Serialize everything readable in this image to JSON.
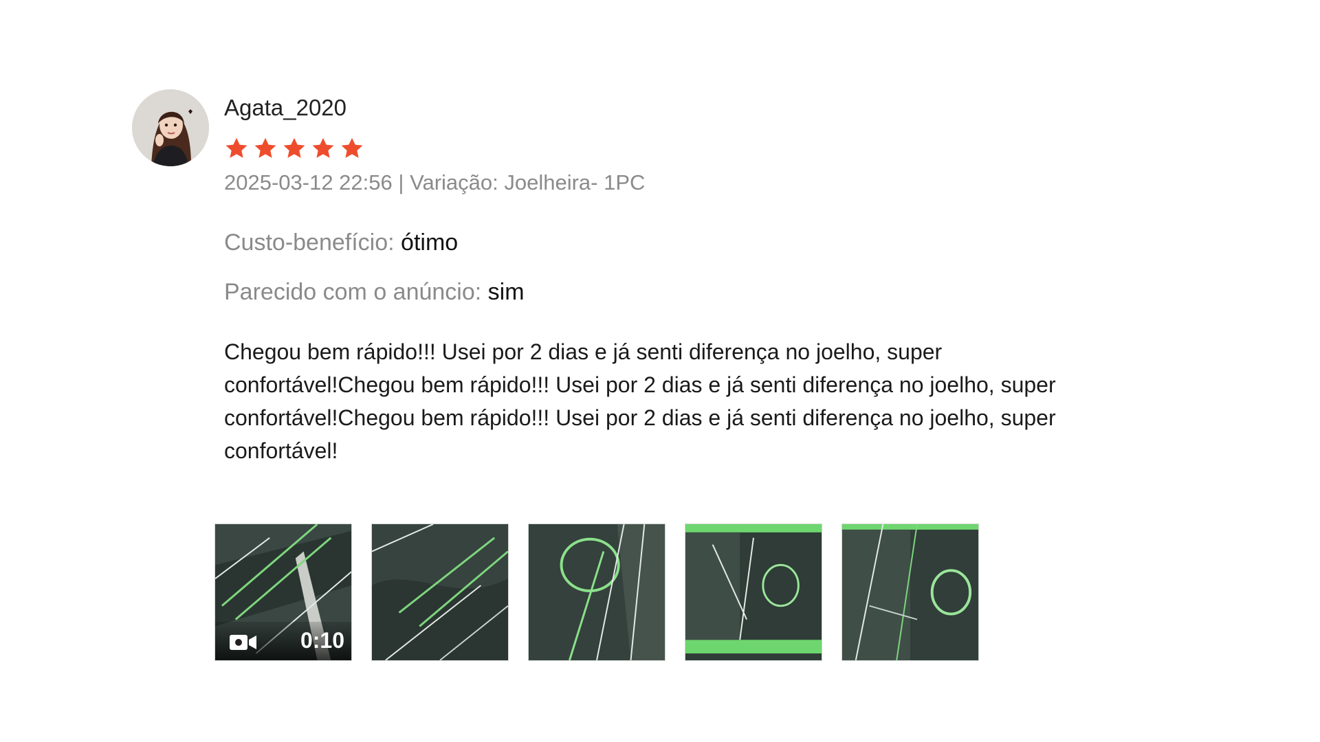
{
  "review": {
    "username": "Agata_2020",
    "rating": 5,
    "rating_max": 5,
    "star_color": "#ee4d2d",
    "date": "2025-03-12 22:56",
    "separator": "|",
    "variation_label": "Variação:",
    "variation_value": "Joelheira- 1PC",
    "attributes": [
      {
        "label": "Custo-benefício:",
        "value": "ótimo"
      },
      {
        "label": "Parecido com o anúncio:",
        "value": "sim"
      }
    ],
    "comment": "Chegou bem rápido!!! Usei por 2 dias e já senti diferença no joelho, super confortável!Chegou bem rápido!!! Usei por 2 dias e já senti diferença no joelho, super confortável!Chegou bem rápido!!! Usei por 2 dias e já senti diferença no joelho, super confortável!",
    "media": {
      "video": {
        "duration": "0:10",
        "icon": "video-camera-icon"
      },
      "photo_count": 4
    }
  }
}
